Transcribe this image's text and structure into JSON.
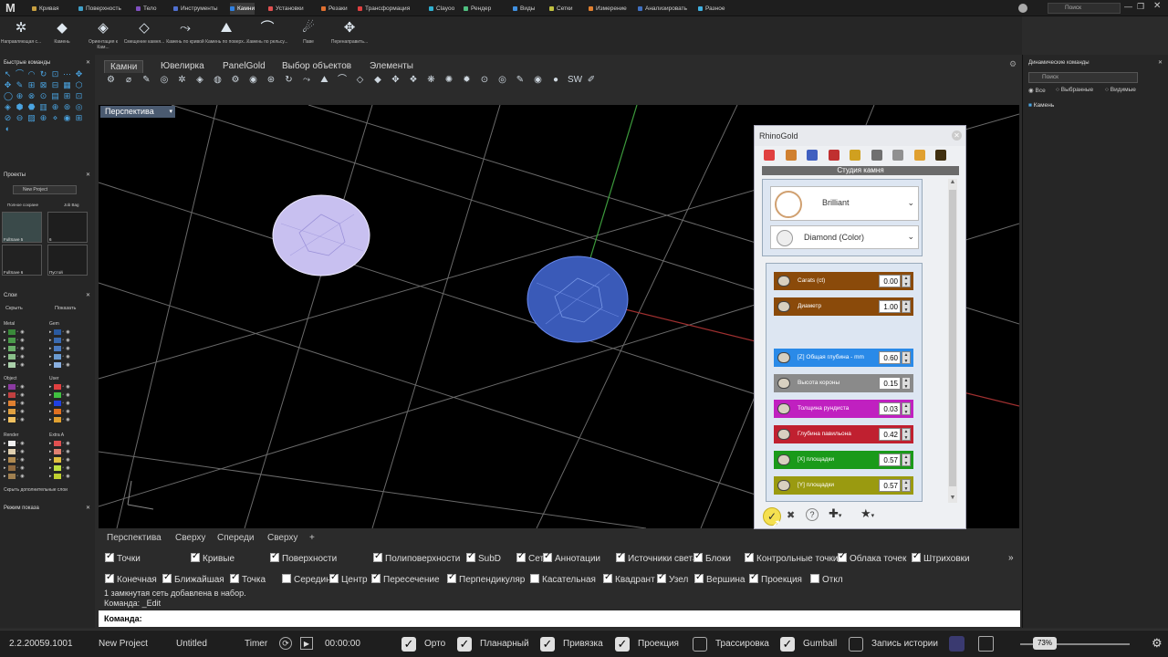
{
  "menu_tabs": [
    "Кривая",
    "Поверхность",
    "Тело",
    "Инструменты",
    "Камни",
    "Установки",
    "Резаки",
    "Трансформация",
    "Clayoo",
    "Рендер",
    "Виды",
    "Сетки",
    "Измерение",
    "Анализировать",
    "Разное"
  ],
  "menu_tab_colors": [
    "#c8a040",
    "#40a0c8",
    "#8050c0",
    "#5070d0",
    "#3080e0",
    "#e05050",
    "#e07030",
    "#e04040",
    "#30b0d0",
    "#50c080",
    "#4090e0",
    "#c0c040",
    "#e08030",
    "#4070c0",
    "#40b0e0"
  ],
  "search_label": "Поиск",
  "ribbon_tools": [
    "Направляющая с...",
    "Камень",
    "Ориентация к Кам...",
    "Смещение камня...",
    "Камень по кривой",
    "Камень по поверх...",
    "Камень по рельсу...",
    "Паве",
    "Перенаправить..."
  ],
  "left": {
    "quick_title": "Быстрые команды",
    "projects_title": "Проекты",
    "project_name": "New Project",
    "proj_btn1": "Полное сохране",
    "proj_btn2": "Job Bag",
    "thumbs": [
      "FullSave 5",
      "6",
      "FullSave 6",
      "Пустой"
    ],
    "layers_title": "Слои",
    "hide": "Скрыть",
    "show": "Показать",
    "layer_groups": [
      "Metal",
      "Gem",
      "Object",
      "User",
      "Render",
      "Extra A"
    ],
    "hide_more": "Скрыть дополнительные слои",
    "display_title": "Режим показа"
  },
  "subtabs": [
    "Камни",
    "Ювелирка",
    "PanelGold",
    "Выбор объектов",
    "Элементы"
  ],
  "viewport_title": "Перспектива",
  "rg": {
    "title": "RhinoGold",
    "studio": "Студия камня",
    "cut": "Brilliant",
    "material": "Diamond (Color)",
    "params": [
      {
        "label": "Carats (ct)",
        "value": "0.00",
        "color": "#8a4a0a"
      },
      {
        "label": "Диаметр",
        "value": "1.00",
        "color": "#8a4a0a"
      },
      {
        "label": "[Z] Общая глубина - mm",
        "value": "0.60",
        "color": "#2a8ae8"
      },
      {
        "label": "Высота короны",
        "value": "0.15",
        "color": "#8a8a8a"
      },
      {
        "label": "Толщина рундиста",
        "value": "0.03",
        "color": "#c020c0"
      },
      {
        "label": "Глубина павильона",
        "value": "0.42",
        "color": "#c02030"
      },
      {
        "label": "[X] площадки",
        "value": "0.57",
        "color": "#1a9a1a"
      },
      {
        "label": "[Y] площадки",
        "value": "0.57",
        "color": "#9a9a10"
      }
    ]
  },
  "right": {
    "title": "Динамические команды",
    "search": "Поиск",
    "radio1": "Все",
    "radio2": "Выбранные",
    "radio3": "Видимые",
    "item": "Камень"
  },
  "viewport_tabs": [
    "Перспектива",
    "Сверху",
    "Спереди",
    "Сверху",
    "+"
  ],
  "filters": [
    {
      "label": "Точки",
      "on": true
    },
    {
      "label": "Кривые",
      "on": true
    },
    {
      "label": "Поверхности",
      "on": true
    },
    {
      "label": "Полиповерхности",
      "on": true
    },
    {
      "label": "SubD",
      "on": true
    },
    {
      "label": "Сети",
      "on": true
    },
    {
      "label": "Аннотации",
      "on": true
    },
    {
      "label": "Источники света",
      "on": true
    },
    {
      "label": "Блоки",
      "on": true
    },
    {
      "label": "Контрольные точки",
      "on": true
    },
    {
      "label": "Облака точек",
      "on": true
    },
    {
      "label": "Штриховки",
      "on": true
    }
  ],
  "osnaps": [
    {
      "label": "Конечная",
      "on": true
    },
    {
      "label": "Ближайшая",
      "on": true
    },
    {
      "label": "Точка",
      "on": true
    },
    {
      "label": "Середина",
      "on": false
    },
    {
      "label": "Центр",
      "on": true
    },
    {
      "label": "Пересечение",
      "on": true
    },
    {
      "label": "Перпендикуляр",
      "on": true
    },
    {
      "label": "Касательная",
      "on": false
    },
    {
      "label": "Квадрант",
      "on": true
    },
    {
      "label": "Узел",
      "on": true
    },
    {
      "label": "Вершина",
      "on": true
    },
    {
      "label": "Проекция",
      "on": true
    },
    {
      "label": "Откл",
      "on": false
    }
  ],
  "cmd": {
    "line1": "1 замкнутая сеть добавлена в набор.",
    "line2": "Команда: _Edit",
    "prompt": "Команда:"
  },
  "status": {
    "version": "2.2.20059.1001",
    "project": "New Project",
    "file": "Untitled",
    "timer": "Timer",
    "time": "00:00:00",
    "zoom": "73%",
    "toggles": [
      {
        "label": "Орто",
        "on": true
      },
      {
        "label": "Планарный",
        "on": true
      },
      {
        "label": "Привязка",
        "on": true
      },
      {
        "label": "Проекция",
        "on": true
      },
      {
        "label": "Трассировка",
        "on": false
      },
      {
        "label": "Gumball",
        "on": true
      },
      {
        "label": "Запись истории",
        "on": false
      }
    ]
  }
}
